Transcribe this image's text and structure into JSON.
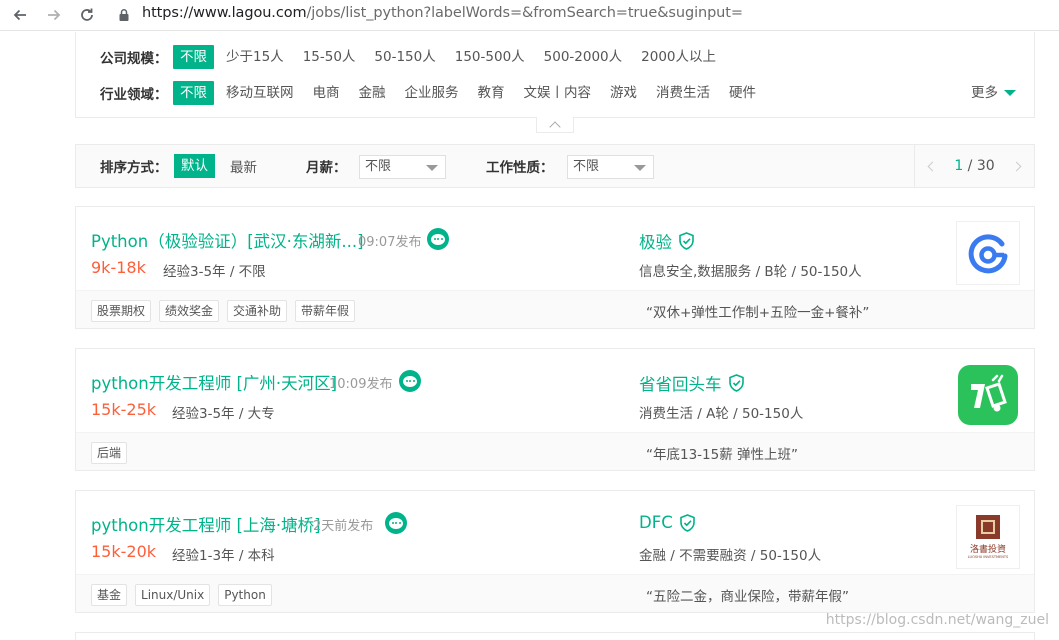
{
  "browser": {
    "url_host": "https://www.lagou.com",
    "url_rest": "/jobs/list_python?labelWords=&fromSearch=true&suginput="
  },
  "filters": {
    "company_size": {
      "label": "公司规模：",
      "options": [
        "不限",
        "少于15人",
        "15-50人",
        "50-150人",
        "150-500人",
        "500-2000人",
        "2000人以上"
      ],
      "selected": "不限"
    },
    "industry": {
      "label": "行业领域：",
      "options": [
        "不限",
        "移动互联网",
        "电商",
        "金融",
        "企业服务",
        "教育",
        "文娱丨内容",
        "游戏",
        "消费生活",
        "硬件"
      ],
      "selected": "不限",
      "more_label": "更多"
    }
  },
  "sort_bar": {
    "sort_label": "排序方式：",
    "sort_default": "默认",
    "sort_newest": "最新",
    "salary_label": "月薪：",
    "salary_value": "不限",
    "type_label": "工作性质：",
    "type_value": "不限",
    "page_current": "1",
    "page_sep": " / ",
    "page_total": "30"
  },
  "jobs": [
    {
      "title": "Python（极验验证）[武汉·东湖新...]",
      "time": "09:07发布",
      "salary": "9k-18k",
      "requirement": "经验3-5年 / 不限",
      "company": "极验",
      "industry": "信息安全,数据服务 / B轮 / 50-150人",
      "tags": [
        "股票期权",
        "绩效奖金",
        "交通补助",
        "带薪年假"
      ],
      "advantage": "“双休+弹性工作制+五险一金+餐补”"
    },
    {
      "title": "python开发工程师 [广州·天河区]",
      "time": "10:09发布",
      "salary": "15k-25k",
      "requirement": "经验3-5年 / 大专",
      "company": "省省回头车",
      "industry": "消费生活 / A轮 / 50-150人",
      "tags": [
        "后端"
      ],
      "advantage": "“年底13-15薪 弹性上班”"
    },
    {
      "title": "python开发工程师 [上海·塘桥]",
      "time": "2天前发布",
      "salary": "15k-20k",
      "requirement": "经验1-3年 / 本科",
      "company": "DFC",
      "industry": "金融 / 不需要融资 / 50-150人",
      "tags": [
        "基金",
        "Linux/Unix",
        "Python"
      ],
      "advantage": "“五险二金，商业保险，带薪年假”"
    }
  ],
  "logo3_text": "洛書投資",
  "logo3_sub": "LUOSHU INVESTMENTS",
  "watermark": "https://blog.csdn.net/wang_zuel",
  "colors": {
    "accent": "#00b38a",
    "salary": "#fd5f39"
  }
}
